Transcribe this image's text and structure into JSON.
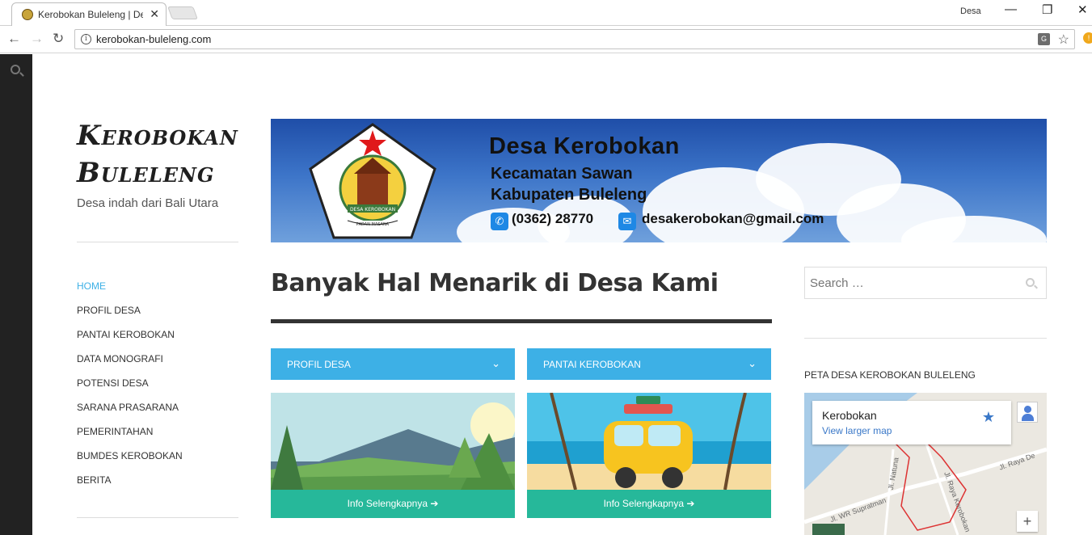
{
  "browser": {
    "tab_title": "Kerobokan Buleleng | De",
    "user_label": "Desa",
    "url": "kerobokan-buleleng.com",
    "translate_glyph": "G",
    "controls": {
      "back": "←",
      "forward": "→",
      "reload": "↻",
      "close_tab": "✕",
      "minimize": "—",
      "restore": "❐",
      "close": "✕",
      "star": "☆",
      "info": "i",
      "ext": "!"
    }
  },
  "site": {
    "title_line1": "Kerobokan",
    "title_line2": "Buleleng",
    "description": "Desa indah dari Bali Utara"
  },
  "menu": {
    "items": [
      {
        "label": "HOME",
        "active": true
      },
      {
        "label": "PROFIL DESA"
      },
      {
        "label": "PANTAI KEROBOKAN"
      },
      {
        "label": "DATA MONOGRAFI"
      },
      {
        "label": "POTENSI DESA"
      },
      {
        "label": "SARANA PRASARANA"
      },
      {
        "label": "PEMERINTAHAN"
      },
      {
        "label": "BUMDES KEROBOKAN"
      },
      {
        "label": "BERITA"
      }
    ]
  },
  "banner": {
    "title": "Desa Kerobokan",
    "line2": "Kecamatan Sawan",
    "line3": "Kabupaten Buleleng",
    "phone": "(0362) 28770",
    "email": "desakerobokan@gmail.com",
    "logo_caption": "DESA KEROBOKAN",
    "logo_motto": "PADAN MASANA"
  },
  "main": {
    "headline": "Banyak Hal Menarik di Desa Kami",
    "cards": [
      {
        "title": "PROFIL DESA",
        "button": "Info Selengkapnya"
      },
      {
        "title": "PANTAI KEROBOKAN",
        "button": "Info Selengkapnya"
      }
    ],
    "chevron": "⌄",
    "arrow": "➔"
  },
  "sidebar": {
    "search_placeholder": "Search …",
    "widget_title": "PETA DESA KEROBOKAN BULELENG",
    "map": {
      "place": "Kerobokan",
      "link": "View larger map",
      "star": "★",
      "zoom_in": "+",
      "roads": [
        "Jl. WR Supratman",
        "Jl. Natuna",
        "Jl. Raya Kerobokan",
        "Jl. Raya De"
      ]
    }
  },
  "colors": {
    "accent": "#3db0e6",
    "button": "#26b89a",
    "sidebar": "#222222"
  }
}
